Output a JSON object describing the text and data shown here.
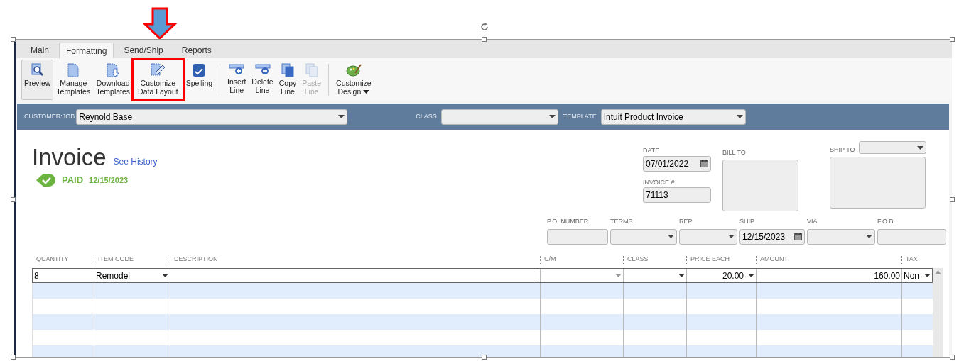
{
  "tabs": [
    {
      "label": "Main",
      "selected": false
    },
    {
      "label": "Formatting",
      "selected": true
    },
    {
      "label": "Send/Ship",
      "selected": false
    },
    {
      "label": "Reports",
      "selected": false
    }
  ],
  "toolbar": [
    {
      "kind": "preview",
      "lines": [
        "Preview"
      ],
      "pressed": true,
      "disabled": false,
      "callout": false
    },
    {
      "kind": "manage",
      "lines": [
        "Manage",
        "Templates"
      ],
      "pressed": false,
      "disabled": false,
      "callout": false
    },
    {
      "kind": "download",
      "lines": [
        "Download",
        "Templates"
      ],
      "pressed": false,
      "disabled": false,
      "callout": false
    },
    {
      "kind": "layout",
      "lines": [
        "Customize",
        "Data Layout"
      ],
      "pressed": false,
      "disabled": false,
      "callout": true
    },
    {
      "kind": "spelling",
      "lines": [
        "Spelling"
      ],
      "pressed": false,
      "disabled": false,
      "callout": false
    },
    {
      "kind": "separator"
    },
    {
      "kind": "insert",
      "lines": [
        "Insert",
        "Line"
      ],
      "pressed": false,
      "disabled": false,
      "callout": false
    },
    {
      "kind": "delete",
      "lines": [
        "Delete",
        "Line"
      ],
      "pressed": false,
      "disabled": false,
      "callout": false
    },
    {
      "kind": "copy",
      "lines": [
        "Copy",
        "Line"
      ],
      "pressed": false,
      "disabled": false,
      "callout": false
    },
    {
      "kind": "paste",
      "lines": [
        "Paste",
        "Line"
      ],
      "pressed": false,
      "disabled": true,
      "callout": false
    },
    {
      "kind": "separator"
    },
    {
      "kind": "design",
      "lines": [
        "Customize",
        "Design"
      ],
      "pressed": false,
      "disabled": false,
      "callout": false
    }
  ],
  "header": {
    "customer_job": {
      "label": "CUSTOMER:JOB",
      "value": "Reynold Base"
    },
    "class": {
      "label": "CLASS"
    },
    "template": {
      "label": "TEMPLATE",
      "value": "Intuit Product Invoice"
    }
  },
  "invoice": {
    "title": "Invoice",
    "history_link": "See History",
    "status": "PAID",
    "status_date": "12/15/2023"
  },
  "date": {
    "label": "DATE",
    "value": "07/01/2022"
  },
  "invoice_number": {
    "label": "INVOICE #",
    "value": "71113"
  },
  "bill_to": {
    "label": "BILL TO"
  },
  "ship_to": {
    "label": "SHIP TO"
  },
  "details": [
    {
      "label": "P.O. NUMBER",
      "kind": "text"
    },
    {
      "label": "TERMS",
      "kind": "dropdown"
    },
    {
      "label": "REP",
      "kind": "dropdown"
    },
    {
      "label": "SHIP",
      "kind": "date",
      "value": "12/15/2023"
    },
    {
      "label": "VIA",
      "kind": "dropdown"
    },
    {
      "label": "F.O.B.",
      "kind": "text"
    }
  ],
  "table": {
    "columns": [
      "QUANTITY",
      "ITEM CODE",
      "DESCRIPTION",
      "U/M",
      "CLASS",
      "PRICE EACH",
      "AMOUNT",
      "TAX"
    ],
    "rows": [
      [
        "8",
        "Remodel",
        "",
        "",
        "",
        "20.00",
        "160.00",
        "Non"
      ]
    ]
  }
}
